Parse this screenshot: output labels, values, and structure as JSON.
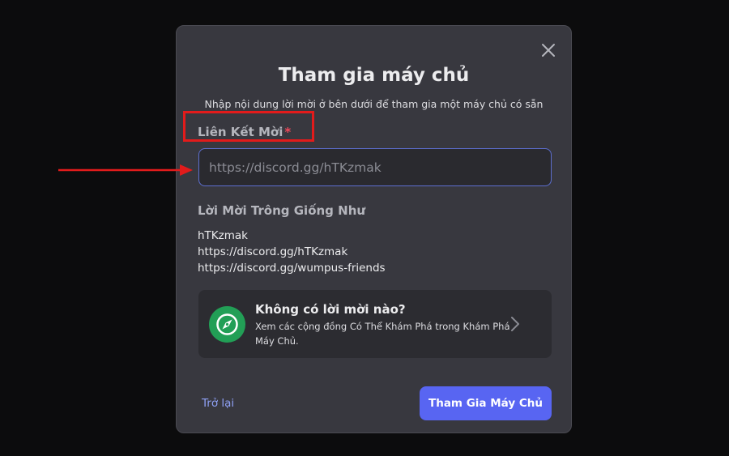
{
  "modal": {
    "title": "Tham gia máy chủ",
    "subtitle": "Nhập nội dung lời mời ở bên dưới để tham gia một máy chủ có sẵn",
    "close_icon": "close-icon"
  },
  "invite_field": {
    "label": "Liên Kết Mời",
    "required_mark": "*",
    "placeholder": "https://discord.gg/hTKzmak",
    "value": ""
  },
  "examples": {
    "heading": "Lời Mời Trông Giống Như",
    "items": [
      "hTKzmak",
      "https://discord.gg/hTKzmak",
      "https://discord.gg/wumpus-friends"
    ]
  },
  "discover": {
    "icon": "compass-icon",
    "title": "Không có lời mời nào?",
    "description": "Xem các cộng đồng Có Thể Khám Phá trong Khám Phá Máy Chủ."
  },
  "footer": {
    "back_label": "Trở lại",
    "join_label": "Tham Gia Máy Chủ"
  },
  "colors": {
    "accent": "#5865f2",
    "link": "#8fa1f5",
    "required": "#f0485a",
    "compass_bg": "#229f56",
    "annotation": "#e21b1b"
  }
}
